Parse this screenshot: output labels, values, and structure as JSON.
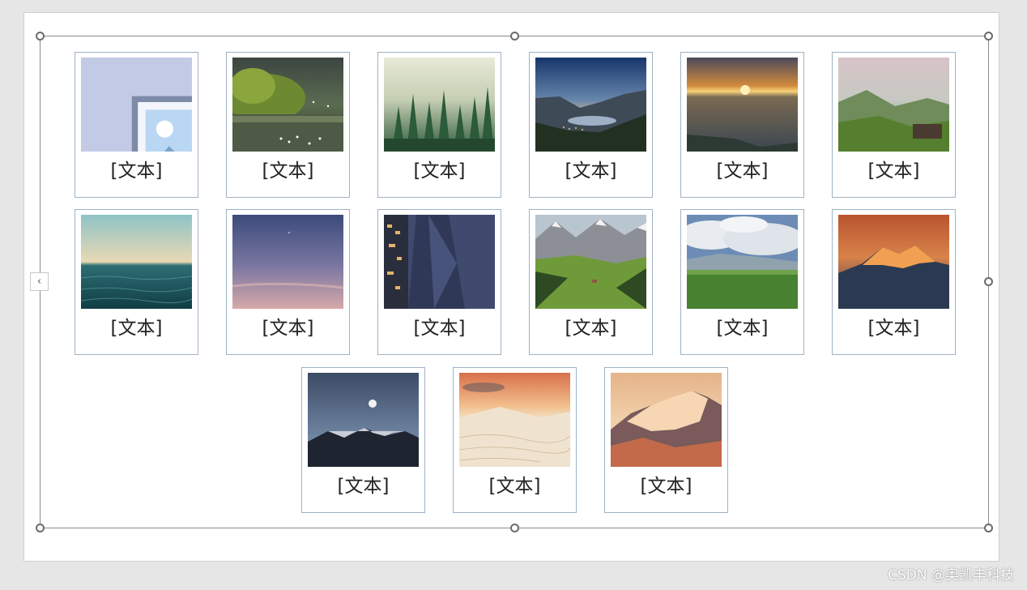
{
  "cards": [
    {
      "caption": "[文本]",
      "image": "image-placeholder-icon"
    },
    {
      "caption": "[文本]",
      "image": "lake-with-swans"
    },
    {
      "caption": "[文本]",
      "image": "misty-pine-forest"
    },
    {
      "caption": "[文本]",
      "image": "fjord-at-dusk"
    },
    {
      "caption": "[文本]",
      "image": "sunset-over-sea"
    },
    {
      "caption": "[文本]",
      "image": "foggy-green-hills"
    },
    {
      "caption": "[文本]",
      "image": "teal-ocean-waves"
    },
    {
      "caption": "[文本]",
      "image": "purple-twilight-sky"
    },
    {
      "caption": "[文本]",
      "image": "night-city-reflection"
    },
    {
      "caption": "[文本]",
      "image": "alpine-valley"
    },
    {
      "caption": "[文本]",
      "image": "green-grassland"
    },
    {
      "caption": "[文本]",
      "image": "orange-glowing-peaks"
    },
    {
      "caption": "[文本]",
      "image": "moon-over-mountains"
    },
    {
      "caption": "[文本]",
      "image": "desert-dunes"
    },
    {
      "caption": "[文本]",
      "image": "sunlit-snow-mountain"
    }
  ],
  "collapse_button": "‹",
  "watermark": "CSDN @奥凯丰科技"
}
